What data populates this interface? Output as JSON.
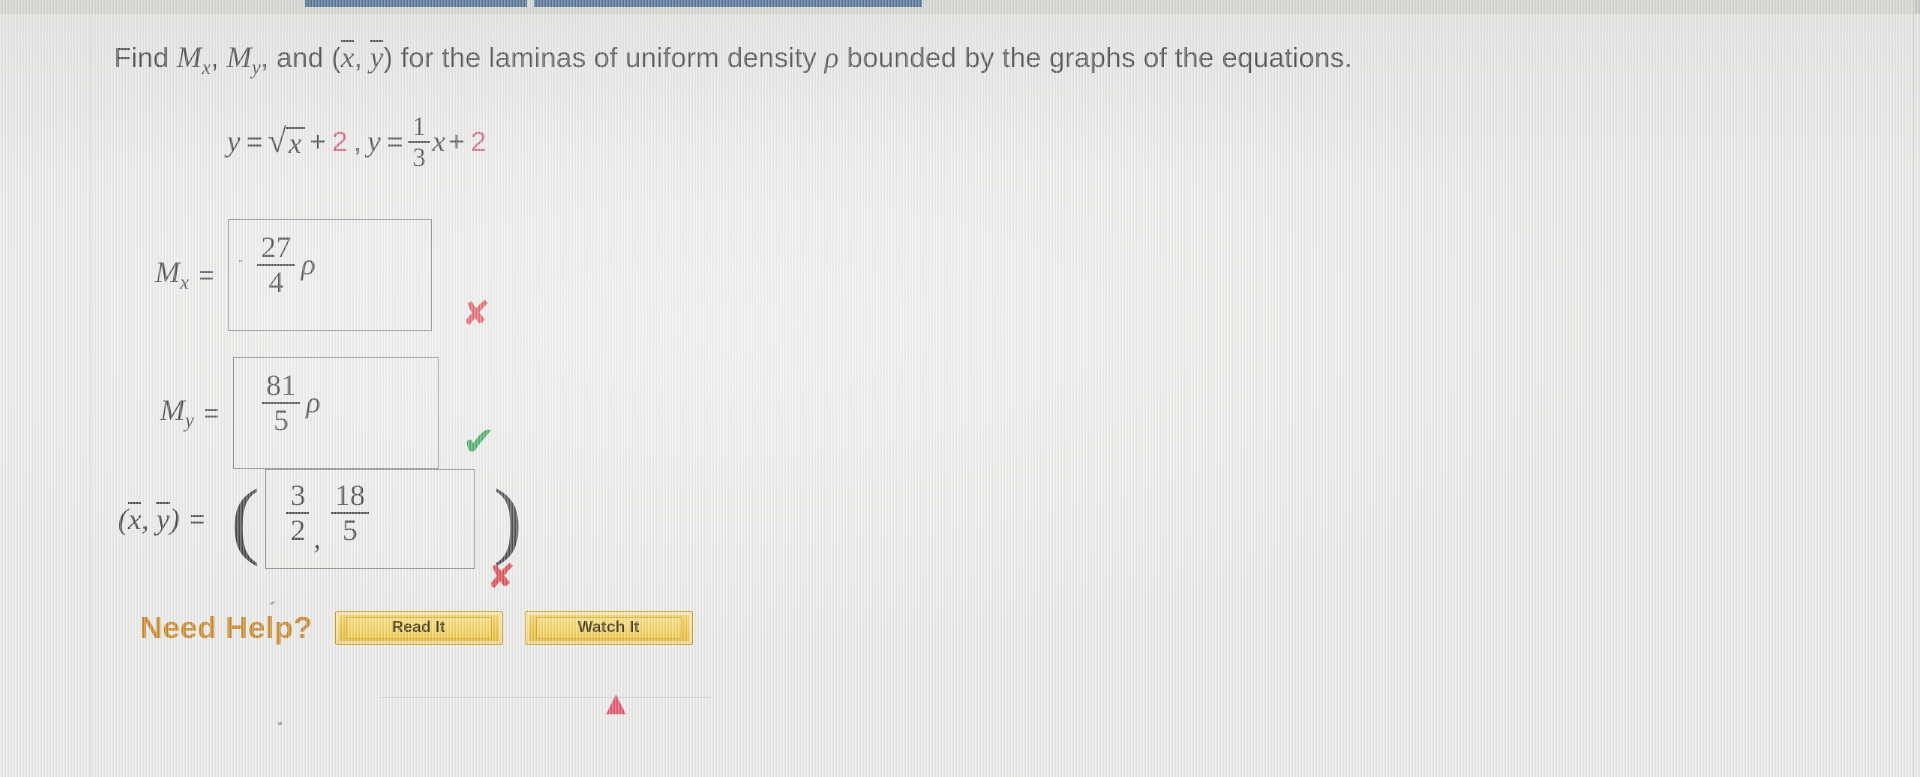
{
  "problem": {
    "prompt_parts": {
      "lead": "Find",
      "m_x": "M",
      "m_x_sub": "x",
      "comma1": ",",
      "m_y": "M",
      "m_y_sub": "y",
      "comma2": ",",
      "and": "and",
      "paren_open": "(",
      "x_bar": "x",
      "mid_comma": ",",
      "y_bar": "y",
      "paren_close": ")",
      "tail": "for the laminas of uniform density",
      "rho": "ρ",
      "tail2": "bounded by the graphs of the equations."
    },
    "equations": {
      "eq1_lhs": "y",
      "eq1_equals": "=",
      "radical_sign": "√",
      "radical_body": "x",
      "eq1_plus": "+",
      "eq1_const": "2",
      "separator": ",",
      "eq2_lhs": "y",
      "eq2_equals": "=",
      "eq2_frac_num": "1",
      "eq2_frac_den": "3",
      "eq2_var": "x",
      "eq2_plus": "+",
      "eq2_const": "2"
    }
  },
  "answers": [
    {
      "label": "M",
      "label_sub": "x",
      "equals": "=",
      "value_num": "27",
      "value_den": "4",
      "value_unit": "ρ",
      "status": "incorrect",
      "status_glyph": "✘"
    },
    {
      "label": "M",
      "label_sub": "y",
      "equals": "=",
      "value_num": "81",
      "value_den": "5",
      "value_unit": "ρ",
      "status": "correct",
      "status_glyph": "✔"
    }
  ],
  "centroid": {
    "label_x": "x",
    "label_comma": ",",
    "label_y": "y",
    "label_paren_open": "(",
    "label_paren_close": ")",
    "equals": "=",
    "group_open": "(",
    "group_close": ")",
    "x_num": "3",
    "x_den": "2",
    "separator": ",",
    "y_num": "18",
    "y_den": "5",
    "status": "incorrect",
    "status_glyph": "✘"
  },
  "help": {
    "label": "Need Help?",
    "buttons": [
      {
        "label": "Read It"
      },
      {
        "label": "Watch It"
      }
    ]
  },
  "colors": {
    "page_background": "#e9eae8",
    "text": "#3e4043",
    "accent_pink": "#cf5a7b",
    "incorrect_red": "#d9444d",
    "correct_green": "#2f9e4f",
    "help_label_orange": "#c98a2e",
    "button_yellow": "#ecc344",
    "chrome_blue": "#3b5f8a",
    "box_border": "#7f8a86"
  },
  "chrome": {
    "bar_1": "",
    "bar_2": ""
  }
}
